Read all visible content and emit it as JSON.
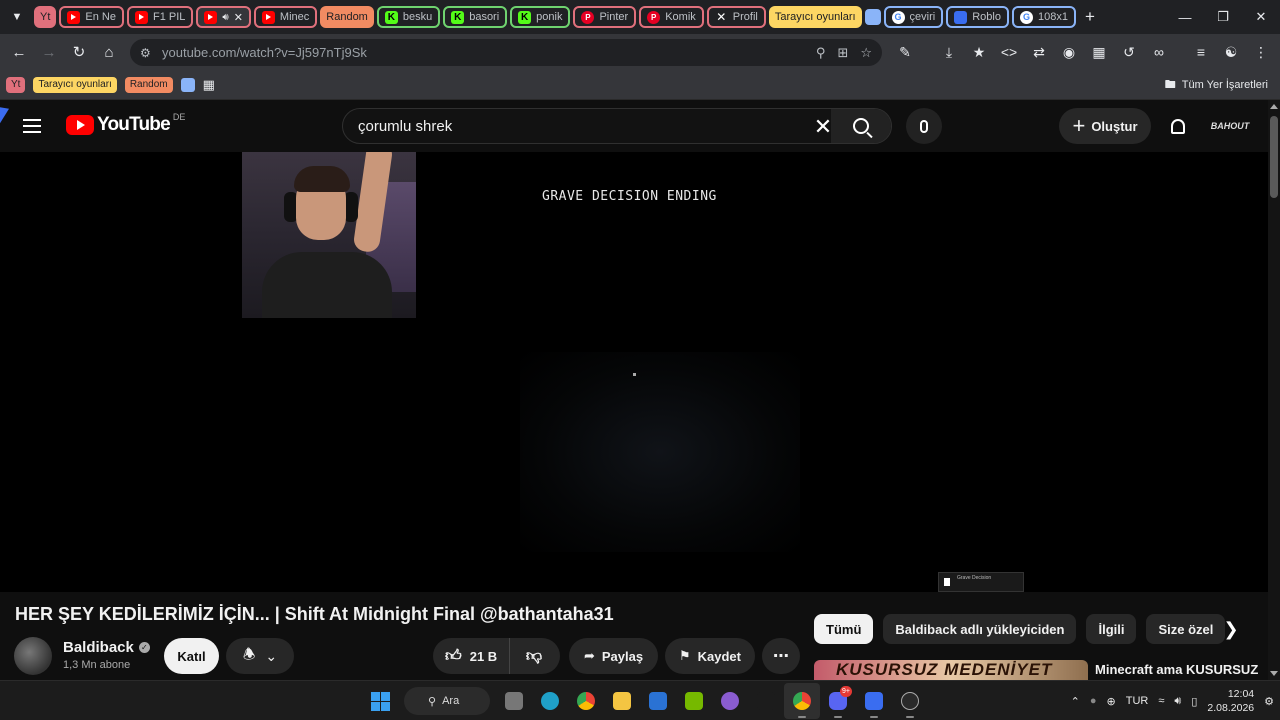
{
  "browser": {
    "tabs": [
      {
        "label": "Yt",
        "style": "group-pink-fill",
        "icon": ""
      },
      {
        "label": "En Ne",
        "style": "group-pink",
        "icon": "youtube-icon"
      },
      {
        "label": "F1 PIL",
        "style": "group-pink",
        "icon": "youtube-icon"
      },
      {
        "label": "",
        "style": "active",
        "icon": "youtube-icon",
        "audio": true
      },
      {
        "label": "Minec",
        "style": "group-pink",
        "icon": "youtube-icon"
      },
      {
        "label": "Random",
        "style": "group-orange",
        "icon": ""
      },
      {
        "label": "besku",
        "style": "group-green",
        "icon": "kick-icon"
      },
      {
        "label": "basori",
        "style": "group-green",
        "icon": "kick-icon"
      },
      {
        "label": "ponik",
        "style": "group-green",
        "icon": "kick-icon"
      },
      {
        "label": "Pinter",
        "style": "group-pink",
        "icon": "pinterest-icon"
      },
      {
        "label": "Komik",
        "style": "group-pink",
        "icon": "pinterest-icon"
      },
      {
        "label": "Profil",
        "style": "group-pink",
        "icon": "x-icon"
      },
      {
        "label": "Tarayıcı oyunları",
        "style": "group-yellow",
        "icon": ""
      },
      {
        "label": "",
        "style": "group-blue-chip",
        "icon": ""
      },
      {
        "label": "çeviri",
        "style": "group-blue",
        "icon": "google-icon"
      },
      {
        "label": "Roblo",
        "style": "group-blue",
        "icon": "roblox-icon"
      },
      {
        "label": "108x1",
        "style": "group-blue",
        "icon": "google-icon"
      }
    ],
    "url": "youtube.com/watch?v=Jj597nTj9Sk"
  },
  "bookmarks": {
    "yt": "Yt",
    "tarayici": "Tarayıcı oyunları",
    "random": "Random",
    "all_bookmarks": "Tüm Yer İşaretleri"
  },
  "youtube": {
    "logo_word": "YouTube",
    "country_code": "DE",
    "search_query": "çorumlu shrek",
    "create_label": "Oluştur",
    "account_tag": "BAHOUT"
  },
  "video": {
    "overlay_caption": "GRAVE DECISION ENDING",
    "toast_title": "Grave Decision",
    "title": "HER ŞEY KEDİLERİMİZ İÇİN... | Shift At Midnight Final @bathantaha31",
    "channel": "Baldiback",
    "subscribers": "1,3 Mn abone",
    "join": "Katıl",
    "likes": "21 B",
    "share": "Paylaş",
    "save": "Kaydet"
  },
  "chips": [
    "Tümü",
    "Baldiback adlı yükleyiciden",
    "İlgili",
    "Size özel"
  ],
  "recommendation": {
    "thumb_text": "KUSURSUZ MEDENİYET",
    "title": "Minecraft ama KUSURSUZ"
  },
  "taskbar": {
    "search_label": "Ara",
    "discord_badge": "9+",
    "lang": "TUR",
    "time": "12:04",
    "date": "2.08.2026"
  }
}
